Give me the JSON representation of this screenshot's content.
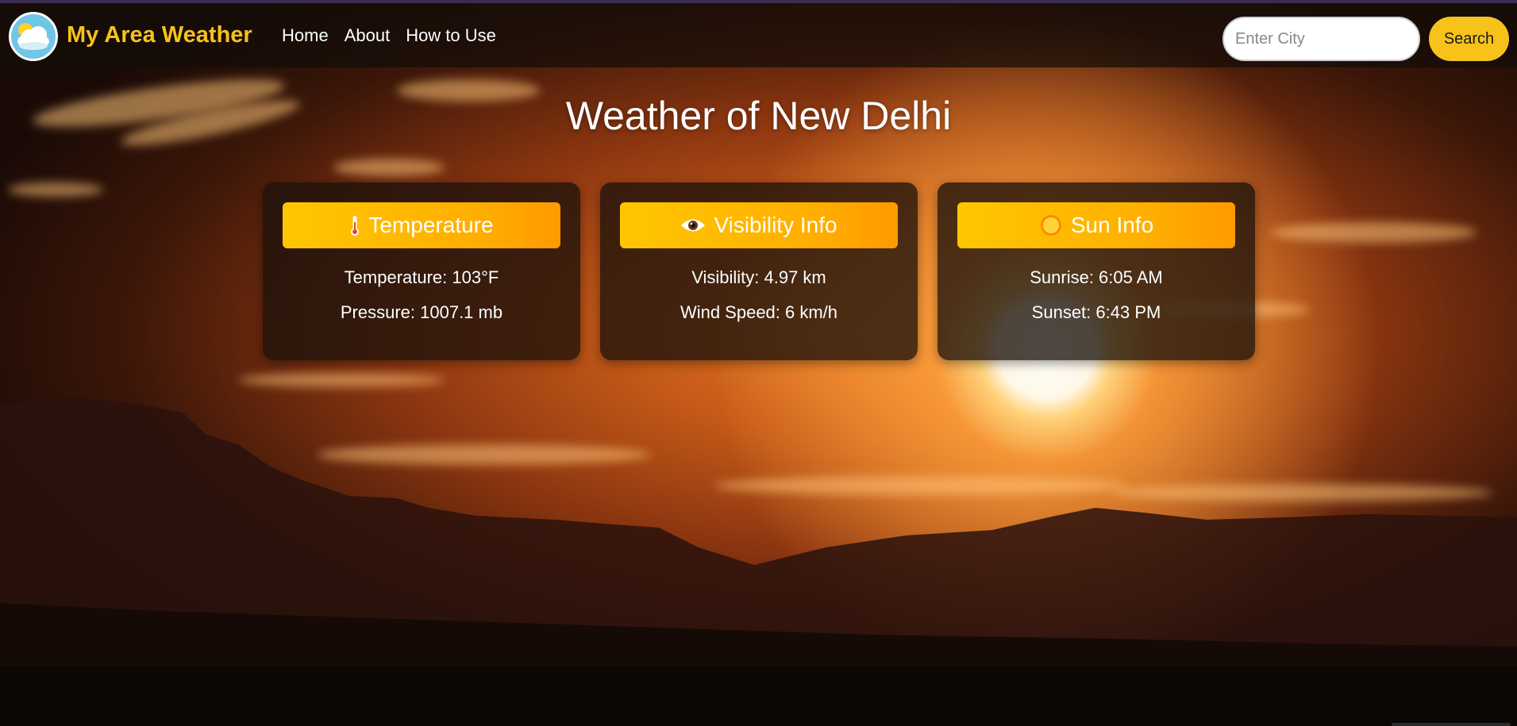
{
  "navbar": {
    "brand": "My Area Weather",
    "logo_icon": "weather-cloud-sun-icon",
    "links": [
      "Home",
      "About",
      "How to Use"
    ],
    "search_placeholder": "Enter City",
    "search_value": "",
    "search_button": "Search"
  },
  "main": {
    "title": "Weather of New Delhi"
  },
  "cards": [
    {
      "icon": "thermometer-icon",
      "header": "Temperature",
      "line1": "Temperature: 103°F",
      "line2": "Pressure: 1007.1 mb"
    },
    {
      "icon": "eye-icon",
      "header": "Visibility Info",
      "line1": "Visibility: 4.97 km",
      "line2": "Wind Speed: 6 km/h"
    },
    {
      "icon": "sun-icon",
      "header": "Sun Info",
      "line1": "Sunrise: 6:05 AM",
      "line2": "Sunset: 6:43 PM"
    }
  ],
  "colors": {
    "brand": "#f7c21a",
    "header_gradient_start": "#ffc700",
    "header_gradient_end": "#ff9a00",
    "card_bg": "rgba(28,18,12,0.78)"
  }
}
